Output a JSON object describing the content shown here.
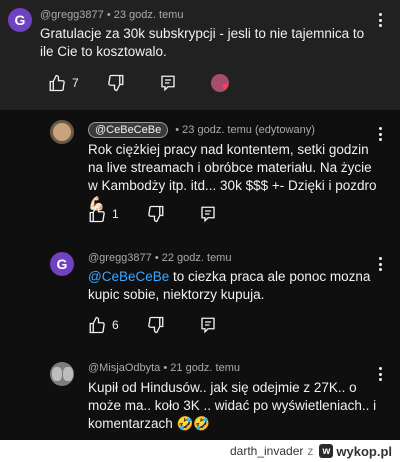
{
  "comments": [
    {
      "avatar_letter": "G",
      "author": "@gregg3877",
      "time": "• 23 godz. temu",
      "text": "Gratulacje za 30k subskrypcji - jesli to nie tajemnica to ile Cie to kosztowalo.",
      "likes": "7"
    },
    {
      "author": "@CeBeCeBe",
      "time": "• 23 godz. temu (edytowany)",
      "text": "Rok ciężkiej pracy nad kontentem, setki godzin na live streamach i obróbce materiału. Na życie w Kambodży itp. itd... 30k $$$ +- Dzięki i pozdro 💪🏻",
      "likes": "1"
    },
    {
      "avatar_letter": "G",
      "author": "@gregg3877",
      "time": "• 22 godz. temu",
      "mention": "@CeBeCeBe",
      "text": " to ciezka praca ale ponoc mozna kupic sobie, niektorzy kupuja.",
      "likes": "6"
    },
    {
      "author": "@MisjaOdbyta",
      "time": "• 21 godz. temu",
      "text": "Kupił od Hindusów.. jak się odejmie z 27K.. o może ma.. koło 3K .. widać po wyświetleniach.. i komentarzach 🤣🤣"
    }
  ],
  "footer": {
    "user": "darth_invader",
    "separator": "z",
    "site": "wykop.pl"
  }
}
